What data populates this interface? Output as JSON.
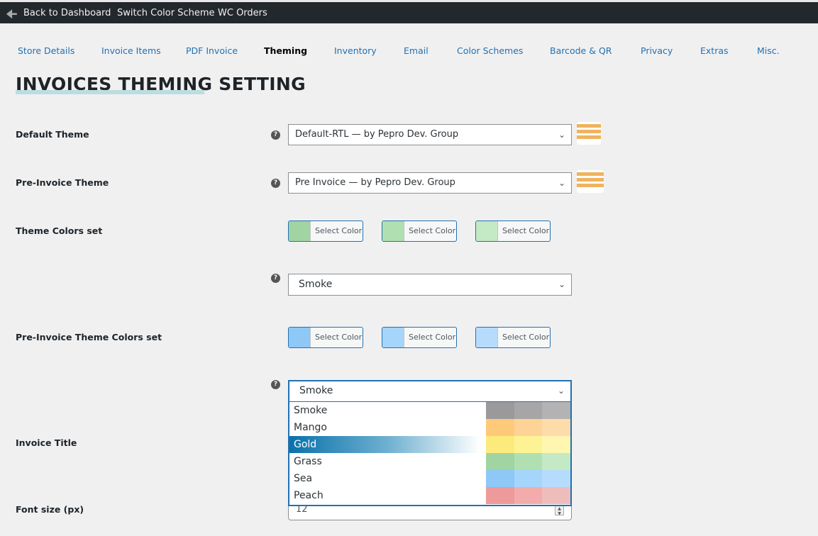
{
  "topbar": {
    "back": "Back to Dashboard",
    "switch": "Switch Color Scheme",
    "orders": "WC Orders"
  },
  "tabs": [
    "Store Details",
    "Invoice Items",
    "PDF Invoice",
    "Theming",
    "Inventory",
    "Email",
    "Color Schemes",
    "Barcode & QR",
    "Privacy",
    "Extras",
    "Misc."
  ],
  "active_tab": "Theming",
  "title": "INVOICES THEMING SETTING",
  "fields": {
    "default_theme": {
      "label": "Default Theme",
      "value": "Default-RTL — by Pepro Dev. Group"
    },
    "pre_invoice_theme": {
      "label": "Pre-Invoice Theme",
      "value": "Pre Invoice — by Pepro Dev. Group"
    },
    "theme_colors": {
      "label": "Theme Colors set",
      "button": "Select Color",
      "colors": [
        "#a1d4a3",
        "#b0e0b1",
        "#c4e9c5"
      ],
      "scheme": "Smoke"
    },
    "pre_invoice_colors": {
      "label": "Pre-Invoice Theme Colors set",
      "button": "Select Color",
      "colors": [
        "#8ec8f7",
        "#a5d5fb",
        "#b6dcfd"
      ],
      "scheme": "Smoke"
    },
    "invoice_title": {
      "label": "Invoice Title"
    },
    "font_size": {
      "label": "Font size (px)",
      "value": "12"
    }
  },
  "help": "?",
  "dropdown_options": [
    {
      "label": "Smoke",
      "colors": [
        "#9a9a9a",
        "#a6a6a6",
        "#b3b3b3"
      ]
    },
    {
      "label": "Mango",
      "colors": [
        "#ffc97a",
        "#fdd396",
        "#fedcaa"
      ]
    },
    {
      "label": "Gold",
      "colors": [
        "#fcea7c",
        "#fef394",
        "#fff6b0"
      ],
      "highlighted": true
    },
    {
      "label": "Grass",
      "colors": [
        "#a1d4a3",
        "#b0e0b1",
        "#c4e9c5"
      ]
    },
    {
      "label": "Sea",
      "colors": [
        "#8ec8f7",
        "#a5d5fb",
        "#b6dcfd"
      ]
    },
    {
      "label": "Peach",
      "colors": [
        "#ee999a",
        "#f4abab",
        "#efbcbc"
      ]
    }
  ],
  "accent": "#2271b1"
}
